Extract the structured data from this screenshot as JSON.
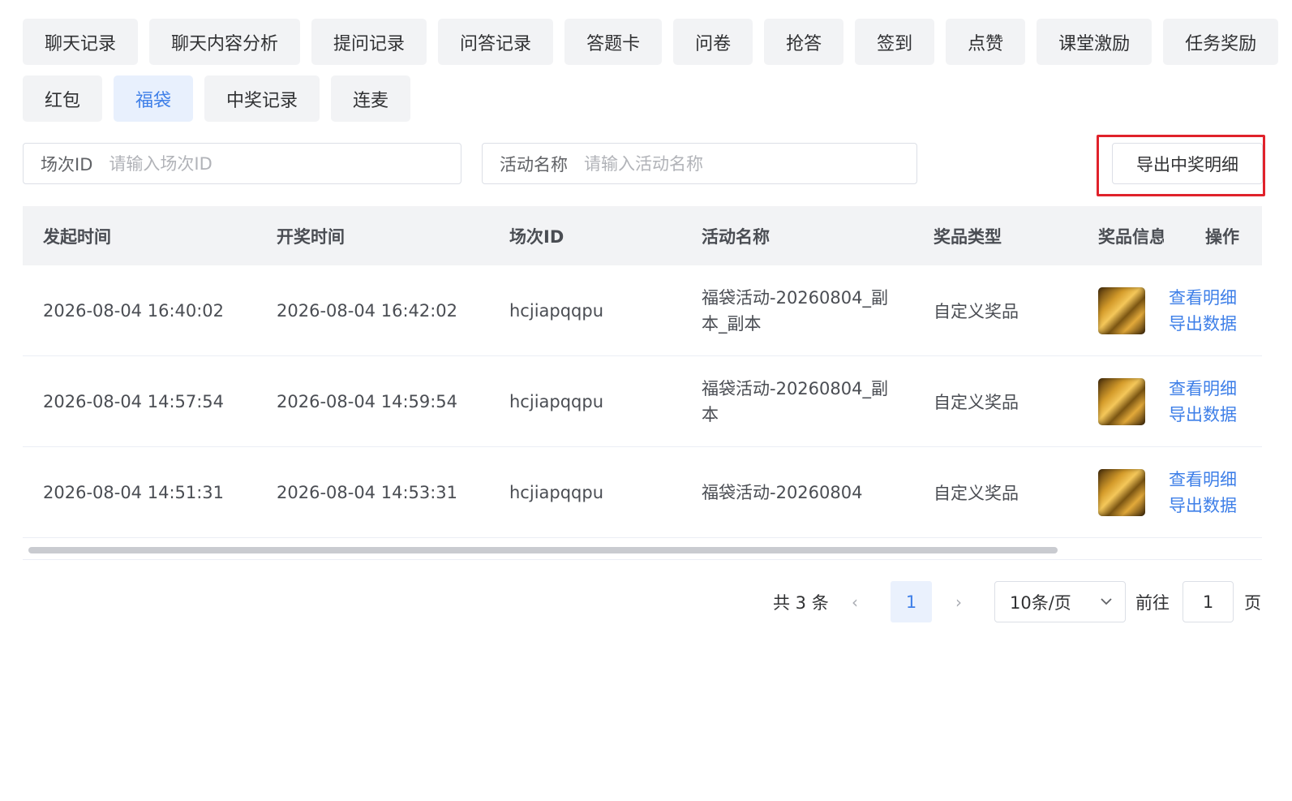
{
  "tabs": {
    "row1": [
      "聊天记录",
      "聊天内容分析",
      "提问记录",
      "问答记录",
      "答题卡",
      "问卷",
      "抢答",
      "签到",
      "点赞",
      "课堂激励",
      "任务奖励"
    ],
    "row2": [
      "红包",
      "福袋",
      "中奖记录",
      "连麦"
    ],
    "active": "福袋"
  },
  "filters": {
    "session": {
      "label": "场次ID",
      "placeholder": "请输入场次ID"
    },
    "activity": {
      "label": "活动名称",
      "placeholder": "请输入活动名称"
    }
  },
  "toolbar": {
    "export_label": "导出中奖明细",
    "highlight_color": "#e0222b"
  },
  "table": {
    "headers": [
      "发起时间",
      "开奖时间",
      "场次ID",
      "活动名称",
      "奖品类型",
      "奖品信息",
      "操作"
    ],
    "rows": [
      {
        "start": "2026-08-04 16:40:02",
        "draw": "2026-08-04 16:42:02",
        "session": "hcjiapqqpu",
        "activity": "福袋活动-20260804_副本_副本",
        "prize_type": "自定义奖品",
        "action1": "查看明细",
        "action2": "导出数据"
      },
      {
        "start": "2026-08-04 14:57:54",
        "draw": "2026-08-04 14:59:54",
        "session": "hcjiapqqpu",
        "activity": "福袋活动-20260804_副本",
        "prize_type": "自定义奖品",
        "action1": "查看明细",
        "action2": "导出数据"
      },
      {
        "start": "2026-08-04 14:51:31",
        "draw": "2026-08-04 14:53:31",
        "session": "hcjiapqqpu",
        "activity": "福袋活动-20260804",
        "prize_type": "自定义奖品",
        "action1": "查看明细",
        "action2": "导出数据"
      }
    ]
  },
  "pagination": {
    "total": "共 3 条",
    "current": "1",
    "page_size": "10条/页",
    "goto_label": "前往",
    "goto_value": "1",
    "page_suffix": "页"
  },
  "colors": {
    "accent": "#3e7fe8",
    "tab_bg": "#f2f3f5",
    "tab_active_bg": "#e8f0fd"
  }
}
